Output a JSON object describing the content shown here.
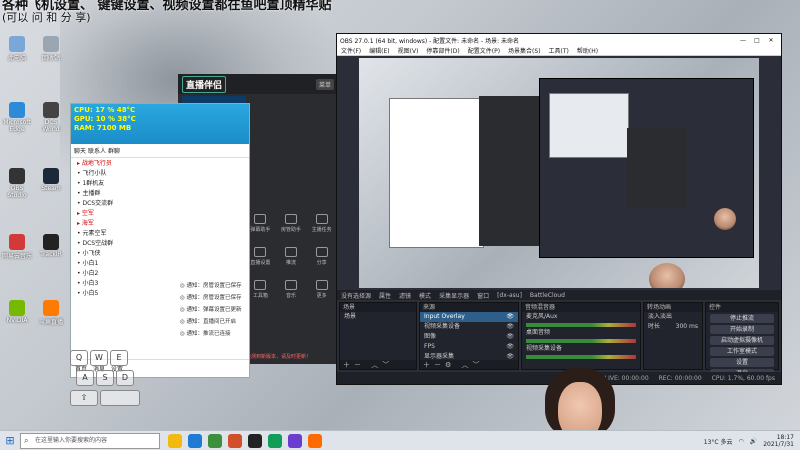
{
  "overlay_caption": {
    "line1": "各种飞机设置、 键键设置、视频设置都在鱼吧置顶精华贴",
    "line2": "(可以 问 和 分 享)"
  },
  "desktop_icons": [
    {
      "label": "此电脑",
      "color": "#7aa7d8"
    },
    {
      "label": "Microsoft Edge",
      "color": "#2b8bd9"
    },
    {
      "label": "OBS Studio",
      "color": "#333333"
    },
    {
      "label": "网易云音乐",
      "color": "#d23a3a"
    },
    {
      "label": "NVIDIA",
      "color": "#76b900"
    },
    {
      "label": "回收站",
      "color": "#9aa7b3"
    },
    {
      "label": "DCS World",
      "color": "#444444"
    },
    {
      "label": "Steam",
      "color": "#1b2838"
    },
    {
      "label": "TrackIR",
      "color": "#222222"
    },
    {
      "label": "斗鱼直播",
      "color": "#ff7a00"
    }
  ],
  "chat_window": {
    "stats": [
      "CPU: 17 % 48°C",
      "GPU: 10 % 38°C",
      "RAM: 7100 MB"
    ],
    "tabs": [
      "聊天",
      "联系人",
      "群聊"
    ],
    "list": [
      {
        "text": "战地飞行员",
        "group": true
      },
      {
        "text": "飞行小队",
        "group": false
      },
      {
        "text": "1群机友",
        "group": false
      },
      {
        "text": "主播群",
        "group": false
      },
      {
        "text": "DCS交流群",
        "group": false
      },
      {
        "text": "空军",
        "group": true
      },
      {
        "text": "海军",
        "group": true
      },
      {
        "text": "元素空军",
        "group": false
      },
      {
        "text": "DCS空战群",
        "group": false
      },
      {
        "text": "小飞侠",
        "group": false
      },
      {
        "text": "小白1",
        "group": false
      },
      {
        "text": "小白2",
        "group": false
      },
      {
        "text": "小白3",
        "group": false
      },
      {
        "text": "小白5",
        "group": false
      }
    ],
    "footer_items": [
      "首页",
      "消息",
      "设置"
    ]
  },
  "assistant": {
    "logo": "直播伴侣",
    "menu_btn": "菜单",
    "grid_items": [
      "弹幕助手",
      "房管助手",
      "主播任务",
      "直播设置",
      "推流",
      "分享",
      "工具箱",
      "音乐",
      "更多"
    ],
    "warning": "检测到新版本，请及时更新！"
  },
  "notifications": [
    "通知：房管设置已保存",
    "通知：房管设置已保存",
    "通知：弹幕设置已更新",
    "通知：直播间已开启",
    "通知：推流已连接"
  ],
  "obs": {
    "title": "OBS 27.0.1 (64 bit, windows) - 配置文件: 未命名 - 场景: 未命名",
    "window_controls": [
      "—",
      "□",
      "✕"
    ],
    "menu": [
      "文件(F)",
      "编辑(E)",
      "视图(V)",
      "停靠部件(D)",
      "配置文件(P)",
      "场景集合(S)",
      "工具(T)",
      "帮助(H)"
    ],
    "toolbar": [
      "没有选择源",
      "属性",
      "滤镜",
      "模式",
      "采集显示器",
      "窗口",
      "[dx-asu]",
      "BattleCloud"
    ],
    "docks": {
      "scenes": {
        "title": "场景",
        "items": [
          "场景"
        ]
      },
      "sources": {
        "title": "来源",
        "items": [
          "Input Overlay",
          "视频采集设备",
          "图像",
          "FPS",
          "显示器采集",
          "窗口采集"
        ]
      },
      "mixer": {
        "title": "音频混音器",
        "channels": [
          "麦克风/Aux",
          "桌面音频",
          "视频采集设备"
        ]
      },
      "transitions": {
        "title": "转场动画",
        "type": "淡入淡出",
        "duration_label": "时长",
        "duration_value": "300 ms"
      },
      "controls": {
        "title": "控件",
        "buttons": [
          "停止推流",
          "开始录制",
          "启动虚拟摄像机",
          "工作室模式",
          "设置",
          "退出"
        ]
      }
    },
    "status": {
      "live": "LIVE: 00:00:00",
      "rec": "REC: 00:00:00",
      "cpu": "CPU: 1.7%, 60.00 fps"
    }
  },
  "taskbar": {
    "search_placeholder": "在这里输入你要搜索的内容",
    "apps": [
      "#f2b90f",
      "#1f7ad3",
      "#3c8f3c",
      "#d14f2a",
      "#222222",
      "#0f9d58",
      "#6a3ccf",
      "#ff6a00"
    ],
    "weather": "13°C 多云",
    "time": "18:17",
    "date": "2021/7/31"
  }
}
